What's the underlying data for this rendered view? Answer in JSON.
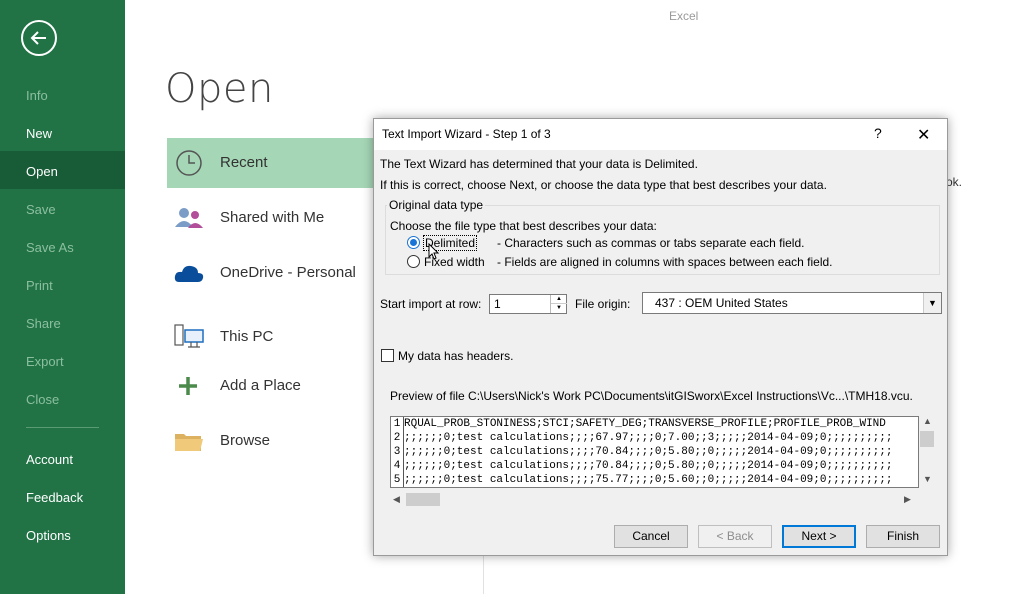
{
  "app": {
    "title": "Excel"
  },
  "sidebar": {
    "items": [
      {
        "label": "Info",
        "disabled": true
      },
      {
        "label": "New",
        "disabled": false
      },
      {
        "label": "Open",
        "disabled": false,
        "selected": true
      },
      {
        "label": "Save",
        "disabled": true
      },
      {
        "label": "Save As",
        "disabled": true
      },
      {
        "label": "Print",
        "disabled": true
      },
      {
        "label": "Share",
        "disabled": true
      },
      {
        "label": "Export",
        "disabled": true
      },
      {
        "label": "Close",
        "disabled": true
      },
      {
        "label": "Account",
        "disabled": false
      },
      {
        "label": "Feedback",
        "disabled": false
      },
      {
        "label": "Options",
        "disabled": false
      }
    ],
    "accent_color": "#217346"
  },
  "main": {
    "title": "Open",
    "places": [
      {
        "label": "Recent",
        "icon": "clock-icon",
        "selected": true
      },
      {
        "label": "Shared with Me",
        "icon": "people-icon"
      },
      {
        "label": "OneDrive - Personal",
        "icon": "cloud-icon"
      },
      {
        "label": "This PC",
        "icon": "computer-icon"
      },
      {
        "label": "Add a Place",
        "icon": "plus-icon"
      },
      {
        "label": "Browse",
        "icon": "folder-icon"
      }
    ],
    "partial_text": "ok."
  },
  "dialog": {
    "title": "Text Import Wizard - Step 1 of 3",
    "help_label": "?",
    "close_label": "✕",
    "intro_line1": "The Text Wizard has determined that your data is Delimited.",
    "intro_line2": "If this is correct, choose Next, or choose the data type that best describes your data.",
    "group_label": "Original data type",
    "group_prompt": "Choose the file type that best describes your data:",
    "options": [
      {
        "label": "Delimited",
        "description": "- Characters such as commas or tabs separate each field.",
        "selected": true
      },
      {
        "label": "Fixed width",
        "description": "- Fields are aligned in columns with spaces between each field.",
        "selected": false
      }
    ],
    "start_row_label": "Start import at row:",
    "start_row_value": "1",
    "origin_label": "File origin:",
    "origin_value": "437 : OEM United States",
    "headers_label": "My data has headers.",
    "headers_checked": false,
    "preview_label": "Preview of file C:\\Users\\Nick's Work PC\\Documents\\itGISworx\\Excel Instructions\\Vc...\\TMH18.vcu.",
    "preview_rows": [
      {
        "num": "1",
        "text": "RQUAL_PROB_STONINESS;STCI;SAFETY_DEG;TRANSVERSE_PROFILE;PROFILE_PROB_WIND"
      },
      {
        "num": "2",
        "text": ";;;;;;0;test calculations;;;;67.97;;;;0;7.00;;3;;;;;2014-04-09;0;;;;;;;;;;"
      },
      {
        "num": "3",
        "text": ";;;;;;0;test calculations;;;;70.84;;;;0;5.80;;0;;;;;2014-04-09;0;;;;;;;;;;"
      },
      {
        "num": "4",
        "text": ";;;;;;0;test calculations;;;;70.84;;;;0;5.80;;0;;;;;2014-04-09;0;;;;;;;;;;"
      },
      {
        "num": "5",
        "text": ";;;;;;0;test calculations;;;;75.77;;;;0;5.60;;0;;;;;2014-04-09;0;;;;;;;;;;"
      }
    ],
    "buttons": {
      "cancel": "Cancel",
      "back": "< Back",
      "next": "Next >",
      "finish": "Finish"
    }
  }
}
